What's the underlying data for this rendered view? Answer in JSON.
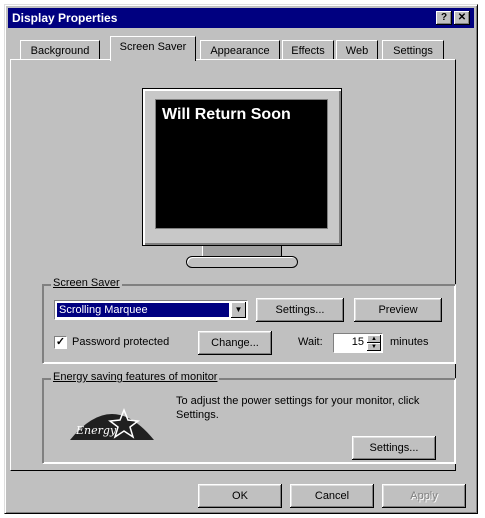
{
  "window": {
    "title": "Display Properties",
    "help_btn": "?",
    "close_btn": "✕"
  },
  "tabs": [
    {
      "label": "Background",
      "active": false
    },
    {
      "label": "Screen Saver",
      "active": true
    },
    {
      "label": "Appearance",
      "active": false
    },
    {
      "label": "Effects",
      "active": false
    },
    {
      "label": "Web",
      "active": false
    },
    {
      "label": "Settings",
      "active": false
    }
  ],
  "preview": {
    "screen_text": "Will Return Soon"
  },
  "screen_saver": {
    "group_label": "Screen Saver",
    "selected": "Scrolling Marquee",
    "settings_btn": "Settings...",
    "preview_btn": "Preview",
    "password_label": "Password protected",
    "password_checked": true,
    "change_btn": "Change...",
    "wait_label": "Wait:",
    "wait_value": "15",
    "minutes_label": "minutes"
  },
  "energy": {
    "group_label": "Energy saving features of monitor",
    "description": "To adjust the power settings for your monitor, click Settings.",
    "logo_text": "Energy",
    "settings_btn": "Settings..."
  },
  "footer": {
    "ok": "OK",
    "cancel": "Cancel",
    "apply": "Apply"
  }
}
